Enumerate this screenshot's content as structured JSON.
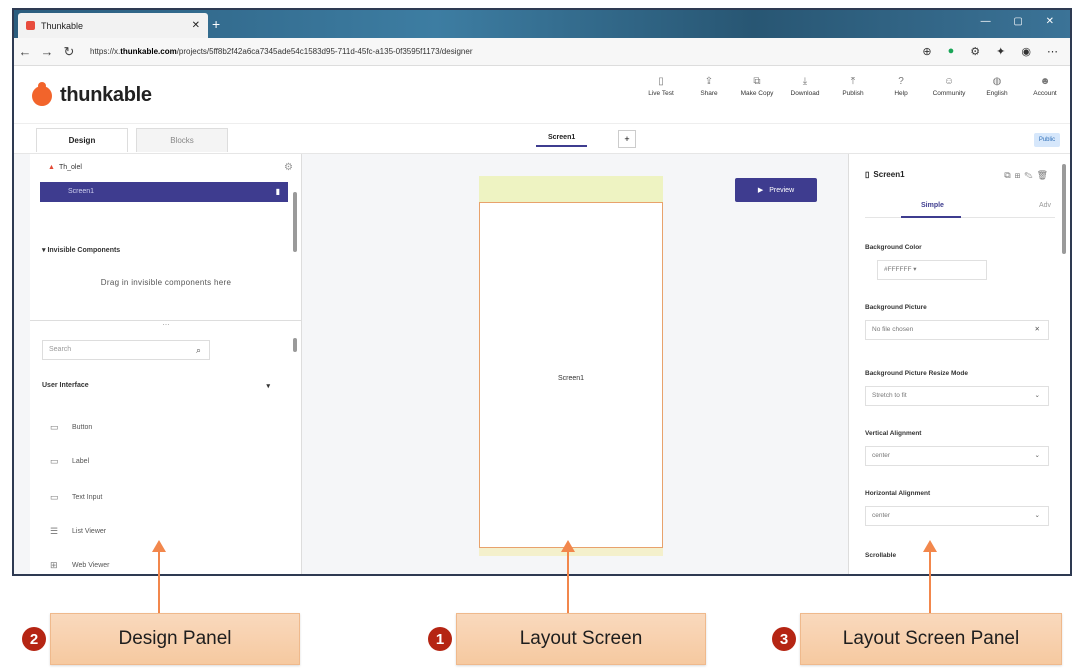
{
  "browser": {
    "tab_title": "Thunkable",
    "url_prefix": "https://x.",
    "url_domain": "thunkable.com",
    "url_rest": "/projects/5ff8b2f42a6ca7345ade54c1583d95-711d-45fc-a135-0f3595f1173/designer",
    "window_controls": "— ▢ ✕"
  },
  "app": {
    "logo_text": "thunkable",
    "top_menu": [
      {
        "label": "Live Test",
        "icon": "phone-icon"
      },
      {
        "label": "Share",
        "icon": "share-icon"
      },
      {
        "label": "Make Copy",
        "icon": "copy-icon"
      },
      {
        "label": "Download",
        "icon": "download-icon"
      },
      {
        "label": "Publish",
        "icon": "publish-icon"
      },
      {
        "label": "Help",
        "icon": "help-icon"
      },
      {
        "label": "Community",
        "icon": "community-icon"
      },
      {
        "label": "English",
        "icon": "globe-icon"
      },
      {
        "label": "Account",
        "icon": "account-icon"
      }
    ]
  },
  "tabs": {
    "design": "Design",
    "blocks": "Blocks",
    "screen_select": "Screen1",
    "add_screen": "+",
    "publish_badge": "Public"
  },
  "design_panel": {
    "project_name": "Th_olel",
    "screen_item": "Screen1",
    "invisible_heading": "▾ Invisible Components",
    "invisible_hint": "Drag in invisible components here",
    "search_placeholder": "Search",
    "category": "User Interface",
    "components": [
      "Button",
      "Label",
      "Text Input",
      "List Viewer",
      "Web Viewer"
    ]
  },
  "canvas": {
    "phone_label": "Screen1",
    "preview_label": "Preview"
  },
  "props_panel": {
    "title": "Screen1",
    "tab_simple": "Simple",
    "tab_advanced": "Adv",
    "fields": [
      {
        "label": "Background Color",
        "value": "#FFFFFF ▾"
      },
      {
        "label": "Background Picture",
        "value": "No file chosen"
      },
      {
        "label": "Background Picture Resize Mode",
        "value": "Stretch to fit"
      },
      {
        "label": "Vertical Alignment",
        "value": "center"
      },
      {
        "label": "Horizontal Alignment",
        "value": "center"
      },
      {
        "label": "Scrollable",
        "value": ""
      }
    ]
  },
  "annotations": [
    {
      "number": "2",
      "label": "Design Panel"
    },
    {
      "number": "1",
      "label": "Layout Screen"
    },
    {
      "number": "3",
      "label": "Layout Screen Panel"
    }
  ],
  "colors": {
    "accent": "#3e3c8f",
    "brand": "#f2642b",
    "annotation_fill": "#f6c9a0",
    "annotation_badge": "#b52513",
    "arrow": "#f2874c"
  }
}
